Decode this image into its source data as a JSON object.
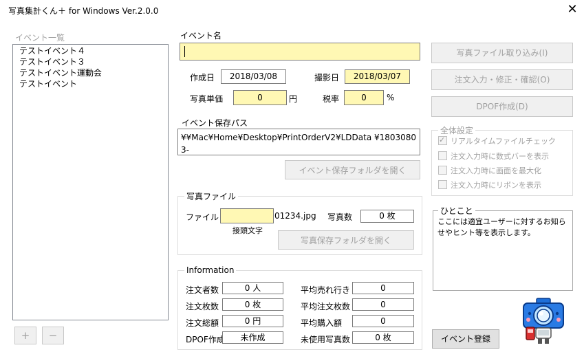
{
  "window": {
    "title": "写真集計くん＋ for Windows Ver.2.0.0",
    "close_glyph": "✕"
  },
  "event_list": {
    "header": "イベント一覧",
    "items": [
      "テストイベント４",
      "テストイベント３",
      "テストイベント運動会",
      "テストイベント"
    ],
    "add_label": "+",
    "remove_label": "−"
  },
  "event_name": {
    "label": "イベント名",
    "value": ""
  },
  "dates": {
    "created_label": "作成日",
    "created_value": "2018/03/08",
    "shot_label": "撮影日",
    "shot_value": "2018/03/07"
  },
  "price": {
    "label": "写真単価",
    "value": "0",
    "unit": "円",
    "tax_label": "税率",
    "tax_value": "0",
    "tax_unit": "%"
  },
  "save_path": {
    "label": "イベント保存パス",
    "value": "¥¥Mac¥Home¥Desktop¥PrintOrderV2¥LDData ¥18030803-",
    "open_button": "イベント保存フォルダを開く"
  },
  "photo_file": {
    "group_title": "写真ファイル",
    "file_label": "ファイル",
    "prefix_value": "",
    "suffix": "01234.jpg",
    "prefix_caption": "接頭文字",
    "count_label": "写真数",
    "count_value": "0 枚",
    "open_button": "写真保存フォルダを開く"
  },
  "information": {
    "group_title": "Information",
    "rows": [
      {
        "left_label": "注文者数",
        "left_value": "0 人",
        "right_label": "平均売れ行き",
        "right_value": "0"
      },
      {
        "left_label": "注文枚数",
        "left_value": "0 枚",
        "right_label": "平均注文枚数",
        "right_value": "0"
      },
      {
        "left_label": "注文総額",
        "left_value": "0 円",
        "right_label": "平均購入額",
        "right_value": "0"
      },
      {
        "left_label": "DPOF作成",
        "left_value": "未作成",
        "right_label": "未使用写真数",
        "right_value": "0 枚"
      }
    ]
  },
  "actions": {
    "import_button": "写真ファイル取り込み(I)",
    "order_button": "注文入力・修正・確認(O)",
    "dpof_button": "DPOF作成(D)",
    "register_button": "イベント登録"
  },
  "global_settings": {
    "group_title": "全体設定",
    "options": [
      {
        "label": "リアルタイムファイルチェック",
        "checked": true
      },
      {
        "label": "注文入力時に数式バーを表示",
        "checked": false
      },
      {
        "label": "注文入力時に画面を最大化",
        "checked": false
      },
      {
        "label": "注文入力時にリボンを表示",
        "checked": false
      }
    ]
  },
  "hint": {
    "group_title": "ひとこと",
    "text": "ここには適宜ユーザーに対するお知らせやヒント等を表示します。"
  },
  "colors": {
    "input_yellow": "#fff8b4",
    "disabled_text": "#a0a0a0",
    "mascot_blue": "#1e6fd8"
  }
}
